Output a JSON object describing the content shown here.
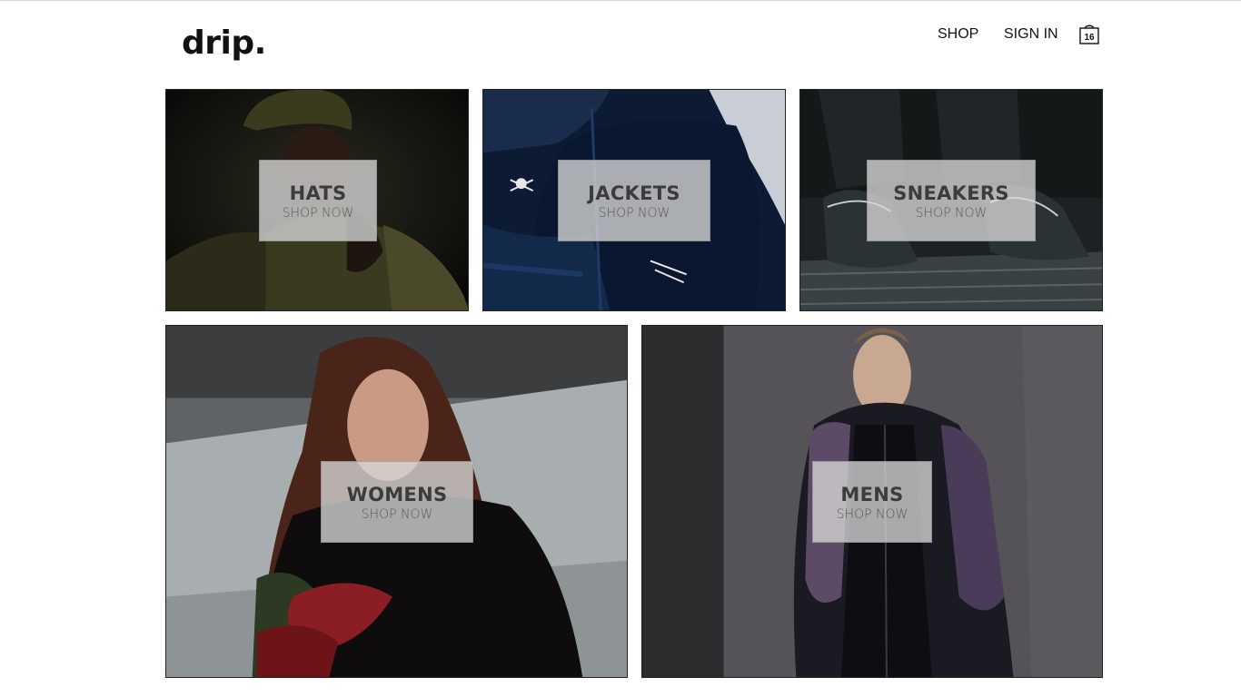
{
  "header": {
    "logo": "drip.",
    "nav": {
      "shop": "SHOP",
      "sign_in": "SIGN IN"
    },
    "cart": {
      "icon": "shopping-bag-icon",
      "count": "16"
    }
  },
  "categories": [
    {
      "title": "HATS",
      "cta": "SHOP NOW"
    },
    {
      "title": "JACKETS",
      "cta": "SHOP NOW"
    },
    {
      "title": "SNEAKERS",
      "cta": "SHOP NOW"
    },
    {
      "title": "WOMENS",
      "cta": "SHOP NOW"
    },
    {
      "title": "MENS",
      "cta": "SHOP NOW"
    }
  ],
  "colors": {
    "text": "#111111",
    "overlay": "#d7d7d7",
    "border": "#222222"
  }
}
